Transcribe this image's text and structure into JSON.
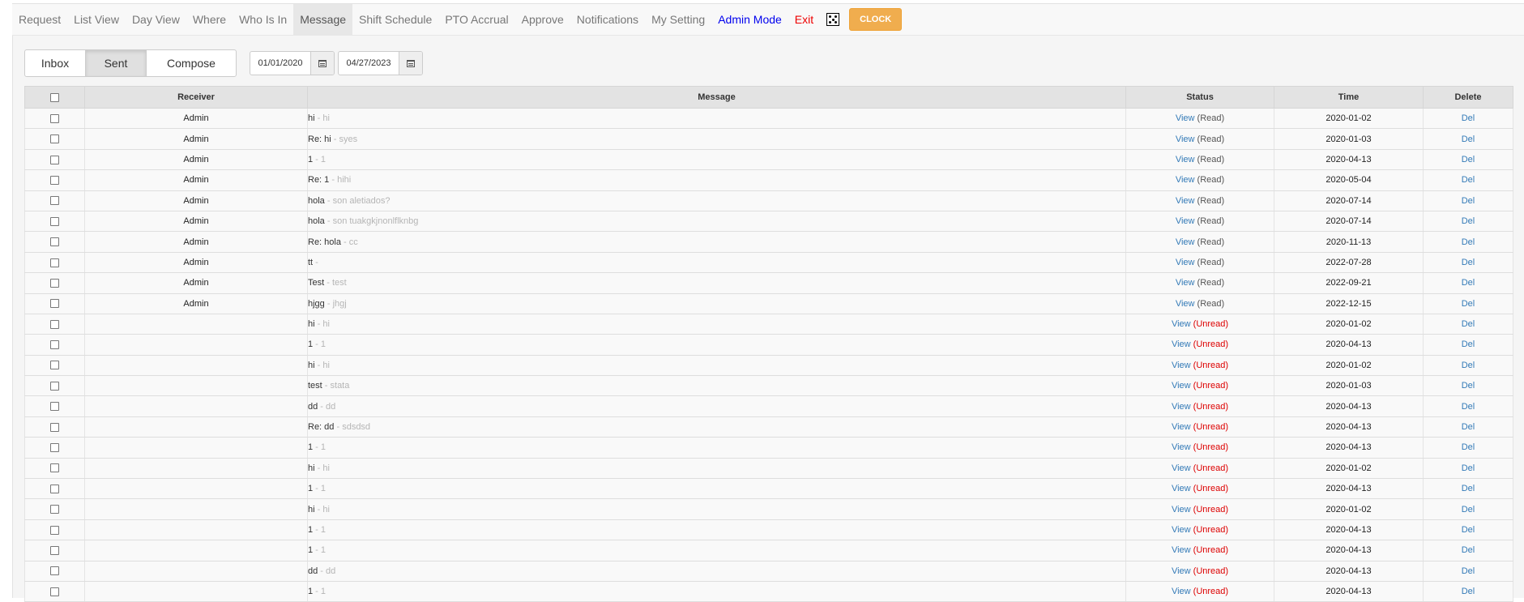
{
  "nav": {
    "items": [
      {
        "label": "Request",
        "style": "normal"
      },
      {
        "label": "List View",
        "style": "normal"
      },
      {
        "label": "Day View",
        "style": "normal"
      },
      {
        "label": "Where",
        "style": "normal"
      },
      {
        "label": "Who Is In",
        "style": "normal"
      },
      {
        "label": "Message",
        "style": "active"
      },
      {
        "label": "Shift Schedule",
        "style": "normal"
      },
      {
        "label": "PTO Accrual",
        "style": "normal"
      },
      {
        "label": "Approve",
        "style": "normal"
      },
      {
        "label": "Notifications",
        "style": "normal"
      },
      {
        "label": "My Setting",
        "style": "normal"
      },
      {
        "label": "Admin Mode",
        "style": "admin"
      },
      {
        "label": "Exit",
        "style": "exit"
      }
    ],
    "dice_icon": "dice-icon",
    "clock_label": "CLOCK"
  },
  "toolbar": {
    "tabs": [
      "Inbox",
      "Sent",
      "Compose"
    ],
    "active_tab": "Sent",
    "date_from": "01/01/2020",
    "date_to": "04/27/2023",
    "calendar_icon": "calendar-icon"
  },
  "table": {
    "headers": {
      "receiver": "Receiver",
      "message": "Message",
      "status": "Status",
      "time": "Time",
      "delete": "Delete"
    },
    "view_label": "View",
    "del_label": "Del",
    "rows": [
      {
        "receiver": "Admin",
        "subject": "hi",
        "snippet": " - hi",
        "status": "(Read)",
        "time": "2020-01-02"
      },
      {
        "receiver": "Admin",
        "subject": "Re: hi",
        "snippet": " - syes",
        "status": "(Read)",
        "time": "2020-01-03"
      },
      {
        "receiver": "Admin",
        "subject": "1",
        "snippet": " - 1",
        "status": "(Read)",
        "time": "2020-04-13"
      },
      {
        "receiver": "Admin",
        "subject": "Re: 1",
        "snippet": " - hihi",
        "status": "(Read)",
        "time": "2020-05-04"
      },
      {
        "receiver": "Admin",
        "subject": "hola",
        "snippet": " - son aletiados?",
        "status": "(Read)",
        "time": "2020-07-14"
      },
      {
        "receiver": "Admin",
        "subject": "hola",
        "snippet": " - son tuakgkjnonlflknbg",
        "status": "(Read)",
        "time": "2020-07-14"
      },
      {
        "receiver": "Admin",
        "subject": "Re: hola",
        "snippet": " - cc",
        "status": "(Read)",
        "time": "2020-11-13"
      },
      {
        "receiver": "Admin",
        "subject": "tt",
        "snippet": " -",
        "status": "(Read)",
        "time": "2022-07-28"
      },
      {
        "receiver": "Admin",
        "subject": "Test",
        "snippet": " - test",
        "status": "(Read)",
        "time": "2022-09-21"
      },
      {
        "receiver": "Admin",
        "subject": "hjgg",
        "snippet": " - jhgj",
        "status": "(Read)",
        "time": "2022-12-15"
      },
      {
        "receiver": "",
        "subject": "hi",
        "snippet": " - hi",
        "status": "(Unread)",
        "time": "2020-01-02"
      },
      {
        "receiver": "",
        "subject": "1",
        "snippet": " - 1",
        "status": "(Unread)",
        "time": "2020-04-13"
      },
      {
        "receiver": "",
        "subject": "hi",
        "snippet": " - hi",
        "status": "(Unread)",
        "time": "2020-01-02"
      },
      {
        "receiver": "",
        "subject": "test",
        "snippet": " - stata",
        "status": "(Unread)",
        "time": "2020-01-03"
      },
      {
        "receiver": "",
        "subject": "dd",
        "snippet": " - dd",
        "status": "(Unread)",
        "time": "2020-04-13"
      },
      {
        "receiver": "",
        "subject": "Re: dd",
        "snippet": " - sdsdsd",
        "status": "(Unread)",
        "time": "2020-04-13"
      },
      {
        "receiver": "",
        "subject": "1",
        "snippet": " - 1",
        "status": "(Unread)",
        "time": "2020-04-13"
      },
      {
        "receiver": "",
        "subject": "hi",
        "snippet": " - hi",
        "status": "(Unread)",
        "time": "2020-01-02"
      },
      {
        "receiver": "",
        "subject": "1",
        "snippet": " - 1",
        "status": "(Unread)",
        "time": "2020-04-13"
      },
      {
        "receiver": "",
        "subject": "hi",
        "snippet": " - hi",
        "status": "(Unread)",
        "time": "2020-01-02"
      },
      {
        "receiver": "",
        "subject": "1",
        "snippet": " - 1",
        "status": "(Unread)",
        "time": "2020-04-13"
      },
      {
        "receiver": "",
        "subject": "1",
        "snippet": " - 1",
        "status": "(Unread)",
        "time": "2020-04-13"
      },
      {
        "receiver": "",
        "subject": "dd",
        "snippet": " - dd",
        "status": "(Unread)",
        "time": "2020-04-13"
      },
      {
        "receiver": "",
        "subject": "1",
        "snippet": " - 1",
        "status": "(Unread)",
        "time": "2020-04-13"
      }
    ]
  },
  "colors": {
    "link": "#337ab7",
    "unread": "#dd0000",
    "admin_mode": "#0000ee",
    "exit": "#ee0000",
    "clock_button": "#f0ad4e"
  }
}
